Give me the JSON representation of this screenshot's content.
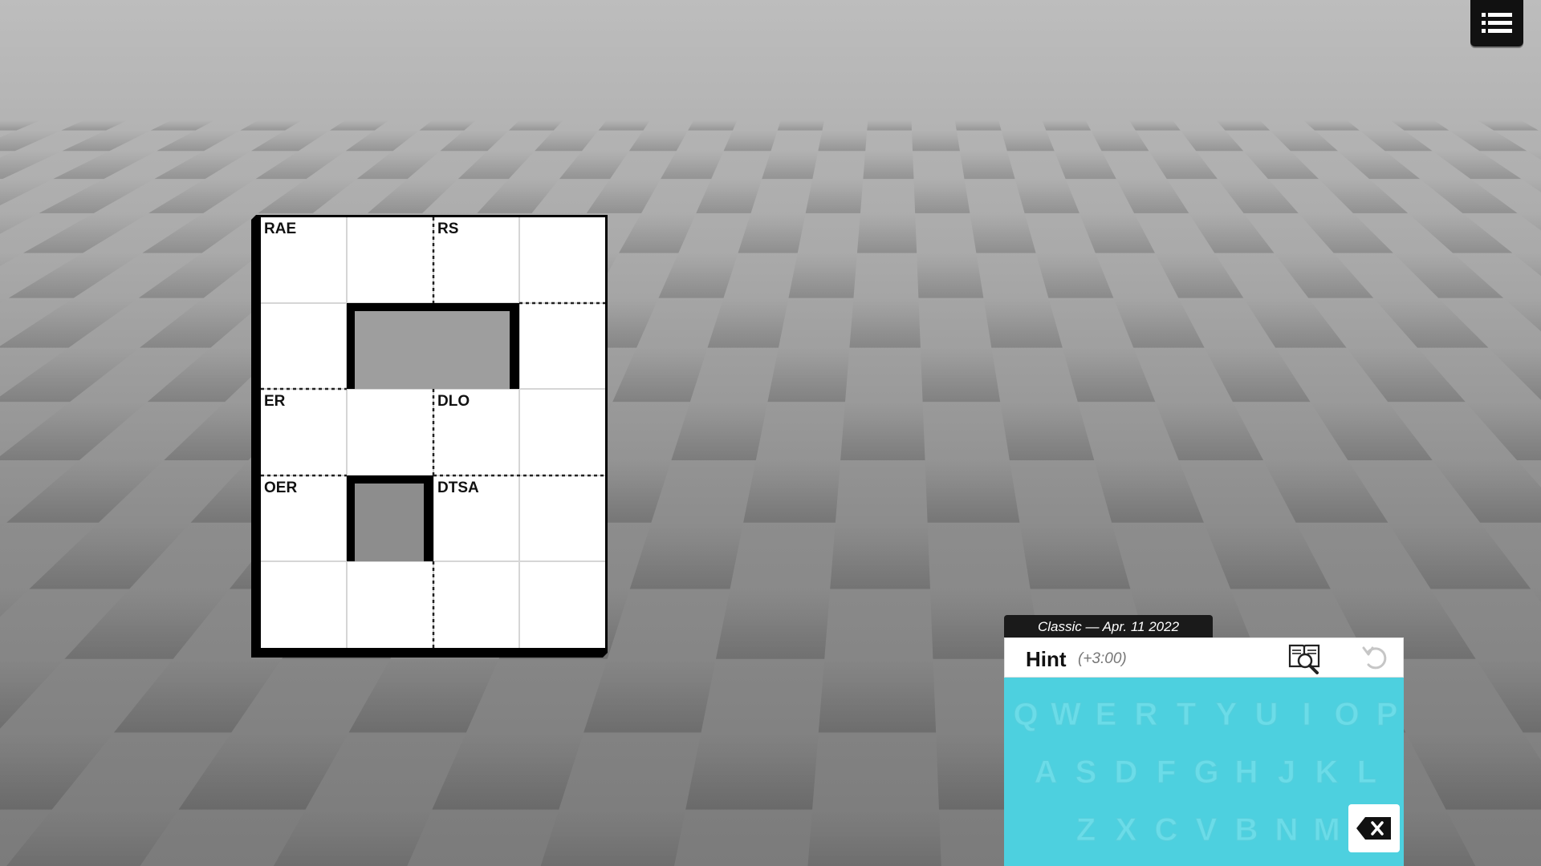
{
  "menu": {
    "icon": "list-menu-icon"
  },
  "board": {
    "clues": [
      {
        "id": "clue-1",
        "text": "RAE",
        "row": 0,
        "col": 0
      },
      {
        "id": "clue-2",
        "text": "RS",
        "row": 0,
        "col": 2
      },
      {
        "id": "clue-3",
        "text": "ER",
        "row": 2,
        "col": 0
      },
      {
        "id": "clue-4",
        "text": "DLO",
        "row": 2,
        "col": 2
      },
      {
        "id": "clue-5",
        "text": "OER",
        "row": 3,
        "col": 0
      },
      {
        "id": "clue-6",
        "text": "DTSA",
        "row": 3,
        "col": 2
      }
    ],
    "rows": 5,
    "cols": 4
  },
  "panel": {
    "date_label": "Classic — Apr. 11 2022",
    "hint_label": "Hint",
    "hint_penalty": "(+3:00)",
    "hint_icon": "book-magnifier-icon",
    "undo_icon": "undo-icon",
    "backspace_icon": "backspace-icon",
    "keyboard_rows": [
      [
        "Q",
        "W",
        "E",
        "R",
        "T",
        "Y",
        "U",
        "I",
        "O",
        "P"
      ],
      [
        "A",
        "S",
        "D",
        "F",
        "G",
        "H",
        "J",
        "K",
        "L"
      ],
      [
        "Z",
        "X",
        "C",
        "V",
        "B",
        "N",
        "M"
      ]
    ]
  },
  "colors": {
    "keyboard": "#4dd0df",
    "board_border": "#000000"
  }
}
